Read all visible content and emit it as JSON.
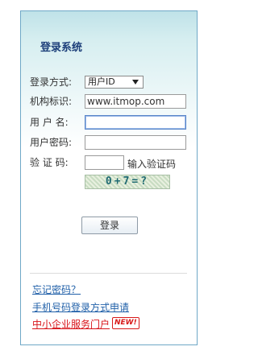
{
  "login": {
    "title": "登录系统",
    "labels": {
      "login_method": "登录方式:",
      "org_id": "机构标识:",
      "username": "用 户 名:",
      "password": "用户密码:",
      "captcha": "验 证 码:"
    },
    "login_method_value": "用户ID",
    "org_id_value": "www.itmop.com",
    "username_value": "",
    "password_value": "",
    "captcha_input_value": "",
    "captcha_hint": "输入验证码",
    "captcha_image_text": "0+7=?",
    "submit_label": "登录"
  },
  "links": {
    "forgot_password": "忘记密码？",
    "mobile_login_apply": "手机号码登录方式申请",
    "sme_portal": "中小企业服务门户",
    "new_badge": "NEW!"
  },
  "colors": {
    "title": "#1d3f7a",
    "link_blue": "#1f5fa8",
    "link_red": "#d8141a",
    "panel_border": "#6fa8c7"
  }
}
